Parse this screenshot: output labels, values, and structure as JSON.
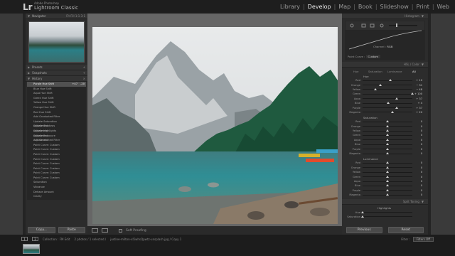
{
  "app": {
    "logo": "Lr",
    "brand_small": "Adobe Photoshop",
    "name": "Lightroom Classic"
  },
  "modules": [
    {
      "label": "Library",
      "active": false
    },
    {
      "label": "Develop",
      "active": true
    },
    {
      "label": "Map",
      "active": false
    },
    {
      "label": "Book",
      "active": false
    },
    {
      "label": "Slideshow",
      "active": false
    },
    {
      "label": "Print",
      "active": false
    },
    {
      "label": "Web",
      "active": false
    }
  ],
  "left": {
    "navigator": {
      "title": "Navigator",
      "zoom": "Fit  Fill  1:1  3:1"
    },
    "presets": {
      "title": "Presets"
    },
    "snapshots": {
      "title": "Snapshots"
    },
    "history": {
      "title": "History",
      "items": [
        {
          "label": "Purple Hue Shift",
          "v1": "+47",
          "v2": "-20",
          "selected": true
        },
        {
          "label": "Blue Hue Shift",
          "v1": "",
          "v2": ""
        },
        {
          "label": "Aqua Hue Shift",
          "v1": "",
          "v2": ""
        },
        {
          "label": "Green Hue Shift",
          "v1": "",
          "v2": ""
        },
        {
          "label": "Yellow Hue Shift",
          "v1": "",
          "v2": ""
        },
        {
          "label": "Orange Hue Shift",
          "v1": "",
          "v2": ""
        },
        {
          "label": "Red Hue Shift",
          "v1": "",
          "v2": ""
        },
        {
          "label": "Add Graduated Filter",
          "v1": "",
          "v2": ""
        },
        {
          "label": "Update Saturation Adjustment",
          "v1": "",
          "v2": ""
        },
        {
          "label": "Update Shadows Adjustment",
          "v1": "",
          "v2": ""
        },
        {
          "label": "Update Highlights Adjustment",
          "v1": "",
          "v2": ""
        },
        {
          "label": "Update Exposure Adjustment",
          "v1": "",
          "v2": ""
        },
        {
          "label": "Add Graduated Filter",
          "v1": "",
          "v2": ""
        },
        {
          "label": "Point Curve: Custom",
          "v1": "",
          "v2": ""
        },
        {
          "label": "Point Curve: Custom",
          "v1": "",
          "v2": ""
        },
        {
          "label": "Point Curve: Custom",
          "v1": "",
          "v2": ""
        },
        {
          "label": "Point Curve: Custom",
          "v1": "",
          "v2": ""
        },
        {
          "label": "Point Curve: Custom",
          "v1": "",
          "v2": ""
        },
        {
          "label": "Point Curve: Custom",
          "v1": "",
          "v2": ""
        },
        {
          "label": "Point Curve: Custom",
          "v1": "",
          "v2": ""
        },
        {
          "label": "Point Curve: Custom",
          "v1": "",
          "v2": ""
        },
        {
          "label": "Saturation",
          "v1": "",
          "v2": ""
        },
        {
          "label": "Vibrance",
          "v1": "",
          "v2": ""
        },
        {
          "label": "Dehaze Amount",
          "v1": "",
          "v2": ""
        },
        {
          "label": "Clarity",
          "v1": "",
          "v2": ""
        }
      ]
    },
    "buttons": {
      "copy": "Copy...",
      "paste": "Paste"
    }
  },
  "toolbar": {
    "soft_proofing": "Soft Proofing"
  },
  "right": {
    "histogram": {
      "title": "Histogram"
    },
    "tone_curve": {
      "channel_label": "Channel :",
      "channel_value": "RGB",
      "point_curve_label": "Point Curve :",
      "point_curve_value": "Custom"
    },
    "hsl": {
      "title": "HSL / Color",
      "tabs": [
        "Hue",
        "Saturation",
        "Luminance",
        "All"
      ],
      "active_tab": "All",
      "sections": [
        {
          "title": "Hue",
          "rows": [
            {
              "label": "Red",
              "value": "+ 10",
              "pos": 0.55
            },
            {
              "label": "Orange",
              "value": "− 31",
              "pos": 0.35
            },
            {
              "label": "Yellow",
              "value": "− 48",
              "pos": 0.26
            },
            {
              "label": "Green",
              "value": "+ 100",
              "pos": 1.0
            },
            {
              "label": "Aqua",
              "value": "+ 37",
              "pos": 0.68
            },
            {
              "label": "Blue",
              "value": "+ 4",
              "pos": 0.52
            },
            {
              "label": "Purple",
              "value": "+ 37",
              "pos": 0.68
            },
            {
              "label": "Magenta",
              "value": "+ 20",
              "pos": 0.6
            }
          ]
        },
        {
          "title": "Saturation",
          "rows": [
            {
              "label": "Red",
              "value": "0",
              "pos": 0.5
            },
            {
              "label": "Orange",
              "value": "0",
              "pos": 0.5
            },
            {
              "label": "Yellow",
              "value": "0",
              "pos": 0.5
            },
            {
              "label": "Green",
              "value": "0",
              "pos": 0.5
            },
            {
              "label": "Aqua",
              "value": "0",
              "pos": 0.5
            },
            {
              "label": "Blue",
              "value": "0",
              "pos": 0.5
            },
            {
              "label": "Purple",
              "value": "0",
              "pos": 0.5
            },
            {
              "label": "Magenta",
              "value": "0",
              "pos": 0.5
            }
          ]
        },
        {
          "title": "Luminance",
          "rows": [
            {
              "label": "Red",
              "value": "0",
              "pos": 0.5
            },
            {
              "label": "Orange",
              "value": "0",
              "pos": 0.5
            },
            {
              "label": "Yellow",
              "value": "0",
              "pos": 0.5
            },
            {
              "label": "Green",
              "value": "0",
              "pos": 0.5
            },
            {
              "label": "Aqua",
              "value": "0",
              "pos": 0.5
            },
            {
              "label": "Blue",
              "value": "0",
              "pos": 0.5
            },
            {
              "label": "Purple",
              "value": "0",
              "pos": 0.5
            },
            {
              "label": "Magenta",
              "value": "0",
              "pos": 0.5
            }
          ]
        }
      ]
    },
    "split_toning": {
      "title": "Split Toning",
      "highlights": "Highlights",
      "hue": "Hue",
      "saturation": "Saturation"
    },
    "buttons": {
      "previous": "Previous",
      "reset": "Reset"
    }
  },
  "filmstrip": {
    "pages": [
      "1",
      "2"
    ],
    "collection_label": "Collection : FM Edit",
    "info": "2 photos / 1 selected /",
    "filename": "justine-milton-xl5whsQpwtz-unsplash.jpg / Copy 1",
    "filter_label": "Filter :",
    "filter_value": "Filters Off"
  }
}
